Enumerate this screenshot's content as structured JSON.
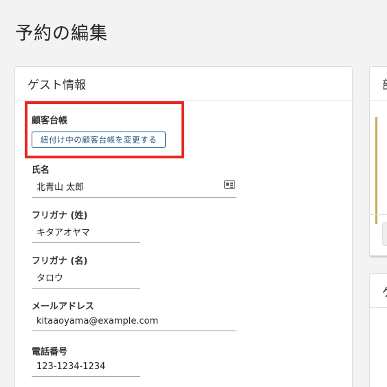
{
  "page": {
    "title": "予約の編集"
  },
  "guest_card": {
    "title": "ゲスト情報",
    "customer_ledger": {
      "label": "顧客台帳",
      "change_button": "紐付け中の顧客台帳を変更する"
    },
    "fields": [
      {
        "label": "氏名",
        "value": "北青山 太郎"
      },
      {
        "label": "フリガナ (姓)",
        "value": "キタアオヤマ"
      },
      {
        "label": "フリガナ (名)",
        "value": "タロウ"
      },
      {
        "label": "メールアドレス",
        "value": "kitaaoyama@example.com"
      },
      {
        "label": "電話番号",
        "value": "123-1234-1234"
      }
    ]
  },
  "right_cards": [
    {
      "title_fragment": "部"
    },
    {
      "title_fragment": "ゲ"
    }
  ],
  "colors": {
    "highlight": "#e8281f",
    "button_border": "#1b5f8f"
  }
}
